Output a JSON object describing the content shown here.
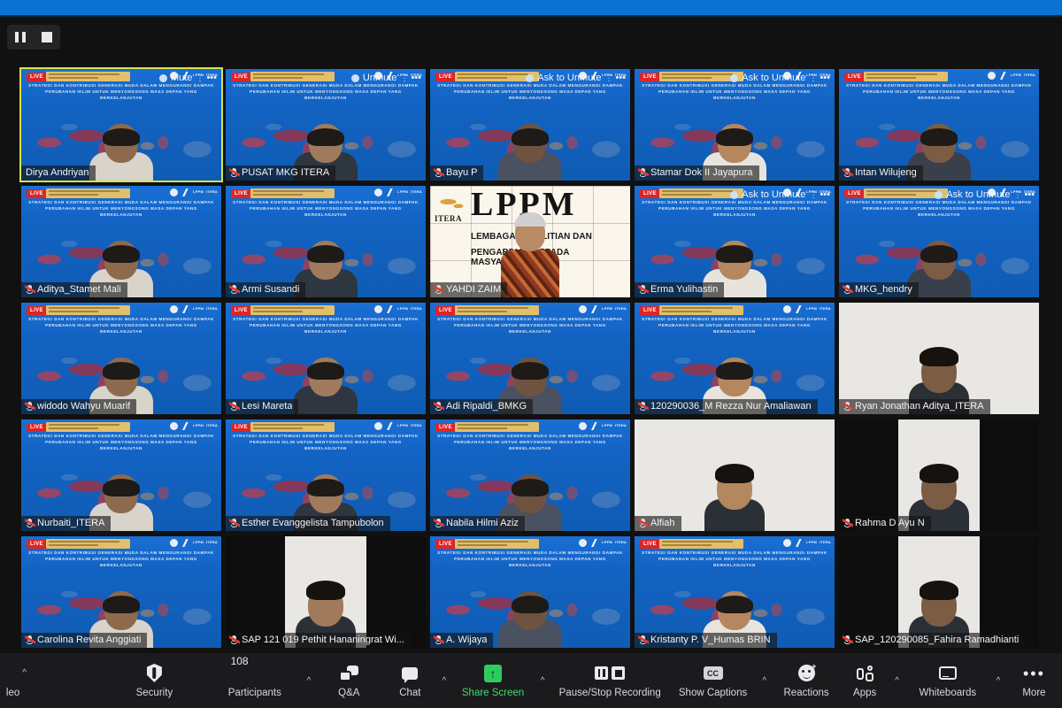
{
  "window": {
    "background_color": "#111111",
    "top_strip_color": "#0a72d1"
  },
  "recording_controls": {
    "pause_label": "Pause Recording",
    "stop_label": "Stop Recording"
  },
  "virtual_background": {
    "live_badge": "LIVE",
    "banner_line1": "STRATEGI DAN KONTRIBUSI GENERASI MUDA DALAM MENGURANGI DAMPAK",
    "banner_line2": "PERUBAHAN IKLIM UNTUK MENYONGSONG MASA DEPAN YANG BERKELANJUTAN",
    "logo_text": "LPPM ITERA"
  },
  "lppm_tile": {
    "institution": "ITERA",
    "acronym": "LPPM",
    "subtitle_line1": "LEMBAGA PENELITIAN DAN",
    "subtitle_line2": "PENGABDIAN KEPADA MASYARAKAT"
  },
  "gallery": {
    "rows": [
      [
        {
          "name": "Dirya Andriyan",
          "ctrl": "Mute",
          "active": true,
          "bg": "vbg",
          "muted": false,
          "has_headset": true
        },
        {
          "name": "PUSAT MKG ITERA",
          "ctrl": "Unmute",
          "active": false,
          "bg": "vbg",
          "muted": true,
          "has_headset": true
        },
        {
          "name": "Bayu P",
          "ctrl": "Ask to Unmute",
          "active": false,
          "bg": "vbg",
          "muted": true,
          "has_headset": false
        },
        {
          "name": "Stamar Dok II Jayapura",
          "ctrl": "Ask to Unmute",
          "active": false,
          "bg": "vbg",
          "muted": true,
          "has_headset": false
        },
        {
          "name": "Intan Wilujeng",
          "ctrl": "",
          "active": false,
          "bg": "vbg",
          "muted": true,
          "has_headset": false
        }
      ],
      [
        {
          "name": "Aditya_Stamet Mali",
          "ctrl": "",
          "active": false,
          "bg": "vbg",
          "muted": true,
          "has_headset": false
        },
        {
          "name": "Armi Susandi",
          "ctrl": "",
          "active": false,
          "bg": "vbg",
          "muted": true,
          "has_headset": false
        },
        {
          "name": "YAHDI ZAIM",
          "ctrl": "",
          "active": false,
          "bg": "lppm",
          "muted": true,
          "has_headset": false
        },
        {
          "name": "Erma Yulihastin",
          "ctrl": "Ask to Unmute",
          "active": false,
          "bg": "vbg",
          "muted": true,
          "has_headset": false
        },
        {
          "name": "MKG_hendry",
          "ctrl": "Ask to Unmute",
          "active": false,
          "bg": "vbg",
          "muted": true,
          "has_headset": true
        }
      ],
      [
        {
          "name": "widodo Wahyu Muarif",
          "ctrl": "",
          "active": false,
          "bg": "vbg",
          "muted": true,
          "has_headset": false
        },
        {
          "name": "Lesi Mareta",
          "ctrl": "",
          "active": false,
          "bg": "vbg",
          "muted": true,
          "has_headset": false
        },
        {
          "name": "Adi Ripaldi_BMKG",
          "ctrl": "",
          "active": false,
          "bg": "vbg",
          "muted": true,
          "has_headset": false
        },
        {
          "name": "120290036_M Rezza Nur Amaliawan",
          "ctrl": "",
          "active": false,
          "bg": "vbg",
          "muted": true,
          "has_headset": false
        },
        {
          "name": "Ryan Jonathan Aditya_ITERA",
          "ctrl": "",
          "active": false,
          "bg": "cam-full",
          "muted": true,
          "has_headset": false
        }
      ],
      [
        {
          "name": "Nurbaiti_ITERA",
          "ctrl": "",
          "active": false,
          "bg": "vbg",
          "muted": true,
          "has_headset": false
        },
        {
          "name": "Esther Evanggelista Tampubolon",
          "ctrl": "",
          "active": false,
          "bg": "vbg",
          "muted": true,
          "has_headset": false
        },
        {
          "name": "Nabila Hilmi Aziz",
          "ctrl": "",
          "active": false,
          "bg": "vbg",
          "muted": true,
          "has_headset": false
        },
        {
          "name": "Alfiah",
          "ctrl": "",
          "active": false,
          "bg": "cam-full",
          "muted": true,
          "has_headset": false
        },
        {
          "name": "Rahma D Ayu N",
          "ctrl": "",
          "active": false,
          "bg": "cam",
          "muted": true,
          "has_headset": false
        }
      ],
      [
        {
          "name": "Carolina Revita Anggiati",
          "ctrl": "",
          "active": false,
          "bg": "vbg",
          "muted": true,
          "has_headset": false
        },
        {
          "name": "SAP 121 019 Pethit Hananingrat Wi...",
          "ctrl": "",
          "active": false,
          "bg": "cam",
          "muted": true,
          "has_headset": false
        },
        {
          "name": "A. Wijaya",
          "ctrl": "",
          "active": false,
          "bg": "vbg",
          "muted": true,
          "has_headset": false
        },
        {
          "name": "Kristanty P. V_Humas BRIN",
          "ctrl": "",
          "active": false,
          "bg": "vbg",
          "muted": true,
          "has_headset": false
        },
        {
          "name": "SAP_120290085_Fahira Ramadhianti",
          "ctrl": "",
          "active": false,
          "bg": "cam",
          "muted": true,
          "has_headset": false
        }
      ]
    ]
  },
  "toolbar": {
    "video_label": "Video",
    "video_label_clipped": "leo",
    "security_label": "Security",
    "participants_label": "Participants",
    "participants_count": "108",
    "qa_label": "Q&A",
    "chat_label": "Chat",
    "share_screen_label": "Share Screen",
    "share_screen_color": "#2ecc5f",
    "recording_label": "Pause/Stop Recording",
    "captions_label": "Show Captions",
    "captions_icon_text": "CC",
    "reactions_label": "Reactions",
    "apps_label": "Apps",
    "whiteboards_label": "Whiteboards",
    "more_label": "More"
  }
}
